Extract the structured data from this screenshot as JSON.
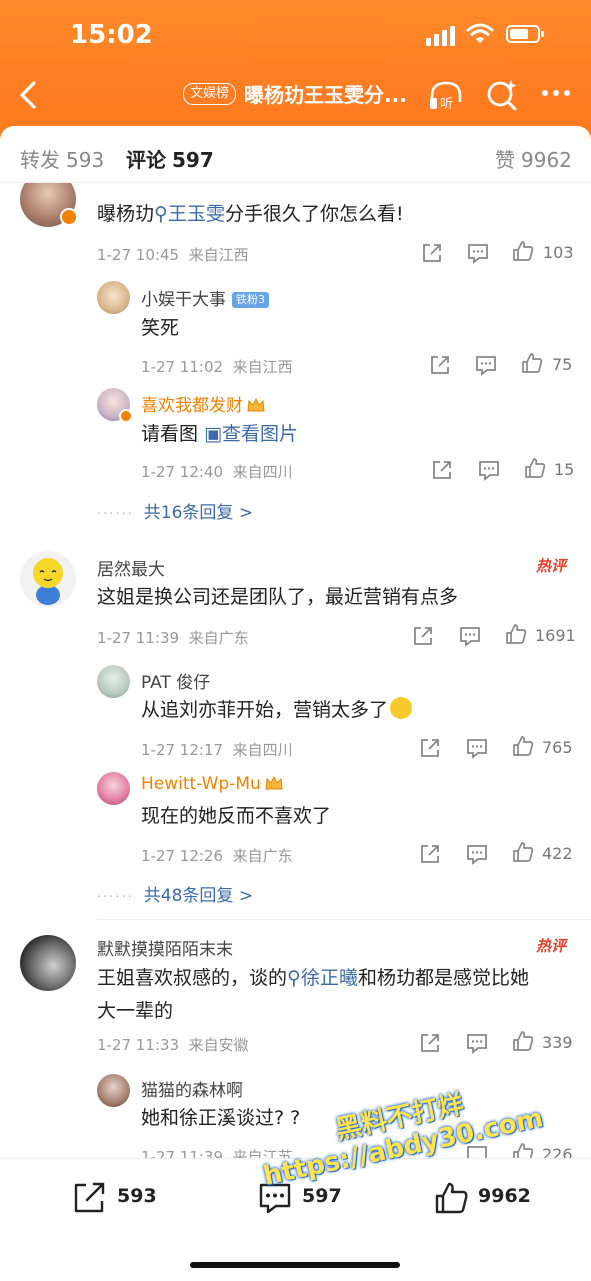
{
  "status_bar": {
    "time": "15:02"
  },
  "nav": {
    "category_badge": "文娱榜",
    "title": "曝杨玏王玉雯分...",
    "listen_label": "听"
  },
  "tabs": [
    {
      "label": "转发",
      "count": "593"
    },
    {
      "label": "评论",
      "count": "597"
    },
    {
      "label": "赞",
      "count": "9962"
    }
  ],
  "comments": [
    {
      "text_prefix": "曝杨玏",
      "link": "王玉雯",
      "text_suffix": "分手很久了你怎么看!",
      "time": "1-27 10:45",
      "location": "来自江西",
      "likes": "103",
      "replies": [
        {
          "name": "小娱干大事",
          "badge": "铁粉3",
          "text": "笑死",
          "time": "1-27 11:02",
          "location": "来自江西",
          "likes": "75"
        },
        {
          "name": "喜欢我都发财",
          "text_prefix": "请看图",
          "link": "查看图片",
          "time": "1-27 12:40",
          "location": "来自四川",
          "likes": "15"
        }
      ],
      "more_replies": "共16条回复 >"
    },
    {
      "name": "居然最大",
      "hot_label": "热评",
      "text": "这姐是换公司还是团队了，最近营销有点多",
      "time": "1-27 11:39",
      "location": "来自广东",
      "likes": "1691",
      "replies": [
        {
          "name": "PAT 俊仔",
          "text": "从追刘亦菲开始，营销太多了",
          "time": "1-27 12:17",
          "location": "来自四川",
          "likes": "765"
        },
        {
          "name": "Hewitt-Wp-Mu",
          "text": "现在的她反而不喜欢了",
          "time": "1-27 12:26",
          "location": "来自广东",
          "likes": "422"
        }
      ],
      "more_replies": "共48条回复 >"
    },
    {
      "name": "默默摸摸陌陌末末",
      "hot_label": "热评",
      "text_line1_prefix": "王姐喜欢叔感的，谈的",
      "link": "徐正曦",
      "text_line1_suffix": "和杨玏都是感觉比她",
      "text_line2": "大一辈的",
      "time": "1-27 11:33",
      "location": "来自安徽",
      "likes": "339",
      "replies": [
        {
          "name": "猫猫的森林啊",
          "text": "她和徐正溪谈过? ?",
          "time": "1-27 11:39",
          "location": "来自江苏",
          "likes": "226"
        }
      ]
    }
  ],
  "bottom_bar": {
    "repost": "593",
    "comment": "597",
    "like": "9962"
  },
  "watermark": {
    "line1": "黑料不打烊",
    "line2": "https://abdy30.com"
  },
  "colors": {
    "header": "#ff7d22",
    "link": "#3d6aa8",
    "hot": "#e8422e",
    "vip_name": "#f08200"
  }
}
